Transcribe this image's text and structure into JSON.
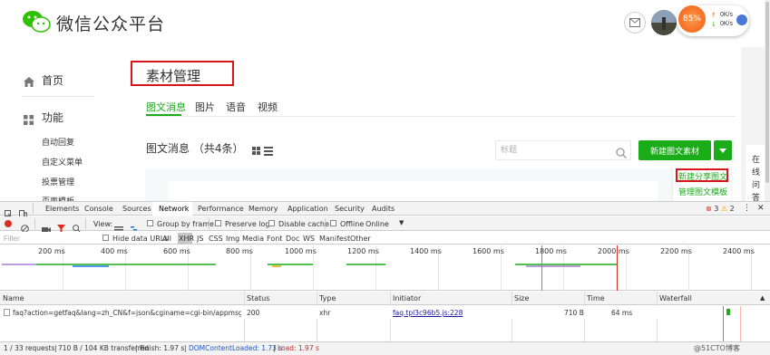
{
  "app": {
    "title": "微信公众平台",
    "speed": {
      "percent": "85%",
      "up": "0K/s",
      "down": "0K/s"
    }
  },
  "sidebar": {
    "home": "首页",
    "functions": "功能",
    "items": [
      "自动回复",
      "自定义菜单",
      "投票管理",
      "页面模板"
    ]
  },
  "page": {
    "title": "素材管理",
    "tabs": [
      "图文消息",
      "图片",
      "语音",
      "视频"
    ],
    "list_heading": "图文消息 （共4条）",
    "search_placeholder": "标题",
    "create_button": "新建图文素材",
    "dropdown": [
      "新建分享图文",
      "管理图文模板"
    ],
    "online_service": "在线问答"
  },
  "devtools": {
    "tabs": [
      "Elements",
      "Console",
      "Sources",
      "Network",
      "Performance",
      "Memory",
      "Application",
      "Security",
      "Audits"
    ],
    "active_tab": "Network",
    "errors": "3",
    "warnings": "2",
    "toolbar": {
      "view_label": "View:",
      "group_by_frame": "Group by frame",
      "preserve_log": "Preserve log",
      "disable_cache": "Disable cache",
      "offline": "Offline",
      "online": "Online"
    },
    "filter_placeholder": "Filter",
    "hide_data_urls": "Hide data URLs",
    "filter_types": [
      "All",
      "XHR",
      "JS",
      "CSS",
      "Img",
      "Media",
      "Font",
      "Doc",
      "WS",
      "Manifest",
      "Other"
    ],
    "active_filter": "XHR",
    "timeline_ticks": [
      "200 ms",
      "400 ms",
      "600 ms",
      "800 ms",
      "1000 ms",
      "1200 ms",
      "1400 ms",
      "1600 ms",
      "1800 ms",
      "2000 ms",
      "2200 ms",
      "2400 ms"
    ],
    "columns": [
      "Name",
      "Status",
      "Type",
      "Initiator",
      "Size",
      "Time",
      "Waterfall"
    ],
    "rows": [
      {
        "name": "faq?action=getfaq&lang=zh_CN&f=json&cginame=cgi-bin/appmsg&toke...",
        "status": "200",
        "type": "xhr",
        "initiator": "faq.tpl3c96b5.js:228",
        "size": "710 B",
        "time": "64 ms"
      }
    ],
    "status": {
      "requests": "1 / 33 requests",
      "transferred": "710 B / 104 KB transferred",
      "finish": "Finish: 1.97 s",
      "dcl": "DOMContentLoaded: 1.73 s",
      "load": "Load: 1.97 s"
    }
  },
  "watermark": "@51CTO博客",
  "colors": {
    "wechat_green": "#1aad19",
    "highlight_red": "#d9141a"
  }
}
